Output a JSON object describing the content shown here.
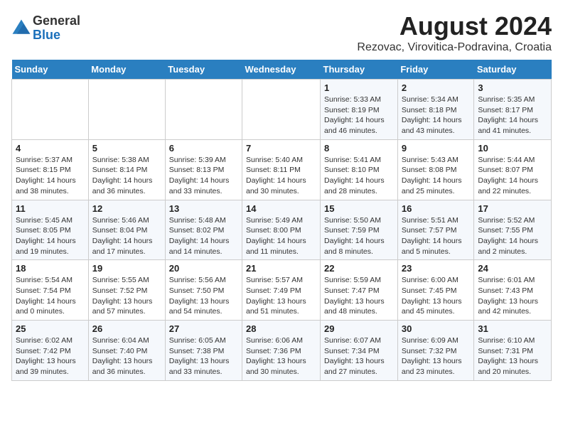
{
  "header": {
    "logo_line1": "General",
    "logo_line2": "Blue",
    "title": "August 2024",
    "subtitle": "Rezovac, Virovitica-Podravina, Croatia"
  },
  "days_of_week": [
    "Sunday",
    "Monday",
    "Tuesday",
    "Wednesday",
    "Thursday",
    "Friday",
    "Saturday"
  ],
  "weeks": [
    [
      {
        "num": "",
        "detail": ""
      },
      {
        "num": "",
        "detail": ""
      },
      {
        "num": "",
        "detail": ""
      },
      {
        "num": "",
        "detail": ""
      },
      {
        "num": "1",
        "detail": "Sunrise: 5:33 AM\nSunset: 8:19 PM\nDaylight: 14 hours and 46 minutes."
      },
      {
        "num": "2",
        "detail": "Sunrise: 5:34 AM\nSunset: 8:18 PM\nDaylight: 14 hours and 43 minutes."
      },
      {
        "num": "3",
        "detail": "Sunrise: 5:35 AM\nSunset: 8:17 PM\nDaylight: 14 hours and 41 minutes."
      }
    ],
    [
      {
        "num": "4",
        "detail": "Sunrise: 5:37 AM\nSunset: 8:15 PM\nDaylight: 14 hours and 38 minutes."
      },
      {
        "num": "5",
        "detail": "Sunrise: 5:38 AM\nSunset: 8:14 PM\nDaylight: 14 hours and 36 minutes."
      },
      {
        "num": "6",
        "detail": "Sunrise: 5:39 AM\nSunset: 8:13 PM\nDaylight: 14 hours and 33 minutes."
      },
      {
        "num": "7",
        "detail": "Sunrise: 5:40 AM\nSunset: 8:11 PM\nDaylight: 14 hours and 30 minutes."
      },
      {
        "num": "8",
        "detail": "Sunrise: 5:41 AM\nSunset: 8:10 PM\nDaylight: 14 hours and 28 minutes."
      },
      {
        "num": "9",
        "detail": "Sunrise: 5:43 AM\nSunset: 8:08 PM\nDaylight: 14 hours and 25 minutes."
      },
      {
        "num": "10",
        "detail": "Sunrise: 5:44 AM\nSunset: 8:07 PM\nDaylight: 14 hours and 22 minutes."
      }
    ],
    [
      {
        "num": "11",
        "detail": "Sunrise: 5:45 AM\nSunset: 8:05 PM\nDaylight: 14 hours and 19 minutes."
      },
      {
        "num": "12",
        "detail": "Sunrise: 5:46 AM\nSunset: 8:04 PM\nDaylight: 14 hours and 17 minutes."
      },
      {
        "num": "13",
        "detail": "Sunrise: 5:48 AM\nSunset: 8:02 PM\nDaylight: 14 hours and 14 minutes."
      },
      {
        "num": "14",
        "detail": "Sunrise: 5:49 AM\nSunset: 8:00 PM\nDaylight: 14 hours and 11 minutes."
      },
      {
        "num": "15",
        "detail": "Sunrise: 5:50 AM\nSunset: 7:59 PM\nDaylight: 14 hours and 8 minutes."
      },
      {
        "num": "16",
        "detail": "Sunrise: 5:51 AM\nSunset: 7:57 PM\nDaylight: 14 hours and 5 minutes."
      },
      {
        "num": "17",
        "detail": "Sunrise: 5:52 AM\nSunset: 7:55 PM\nDaylight: 14 hours and 2 minutes."
      }
    ],
    [
      {
        "num": "18",
        "detail": "Sunrise: 5:54 AM\nSunset: 7:54 PM\nDaylight: 14 hours and 0 minutes."
      },
      {
        "num": "19",
        "detail": "Sunrise: 5:55 AM\nSunset: 7:52 PM\nDaylight: 13 hours and 57 minutes."
      },
      {
        "num": "20",
        "detail": "Sunrise: 5:56 AM\nSunset: 7:50 PM\nDaylight: 13 hours and 54 minutes."
      },
      {
        "num": "21",
        "detail": "Sunrise: 5:57 AM\nSunset: 7:49 PM\nDaylight: 13 hours and 51 minutes."
      },
      {
        "num": "22",
        "detail": "Sunrise: 5:59 AM\nSunset: 7:47 PM\nDaylight: 13 hours and 48 minutes."
      },
      {
        "num": "23",
        "detail": "Sunrise: 6:00 AM\nSunset: 7:45 PM\nDaylight: 13 hours and 45 minutes."
      },
      {
        "num": "24",
        "detail": "Sunrise: 6:01 AM\nSunset: 7:43 PM\nDaylight: 13 hours and 42 minutes."
      }
    ],
    [
      {
        "num": "25",
        "detail": "Sunrise: 6:02 AM\nSunset: 7:42 PM\nDaylight: 13 hours and 39 minutes."
      },
      {
        "num": "26",
        "detail": "Sunrise: 6:04 AM\nSunset: 7:40 PM\nDaylight: 13 hours and 36 minutes."
      },
      {
        "num": "27",
        "detail": "Sunrise: 6:05 AM\nSunset: 7:38 PM\nDaylight: 13 hours and 33 minutes."
      },
      {
        "num": "28",
        "detail": "Sunrise: 6:06 AM\nSunset: 7:36 PM\nDaylight: 13 hours and 30 minutes."
      },
      {
        "num": "29",
        "detail": "Sunrise: 6:07 AM\nSunset: 7:34 PM\nDaylight: 13 hours and 27 minutes."
      },
      {
        "num": "30",
        "detail": "Sunrise: 6:09 AM\nSunset: 7:32 PM\nDaylight: 13 hours and 23 minutes."
      },
      {
        "num": "31",
        "detail": "Sunrise: 6:10 AM\nSunset: 7:31 PM\nDaylight: 13 hours and 20 minutes."
      }
    ]
  ]
}
